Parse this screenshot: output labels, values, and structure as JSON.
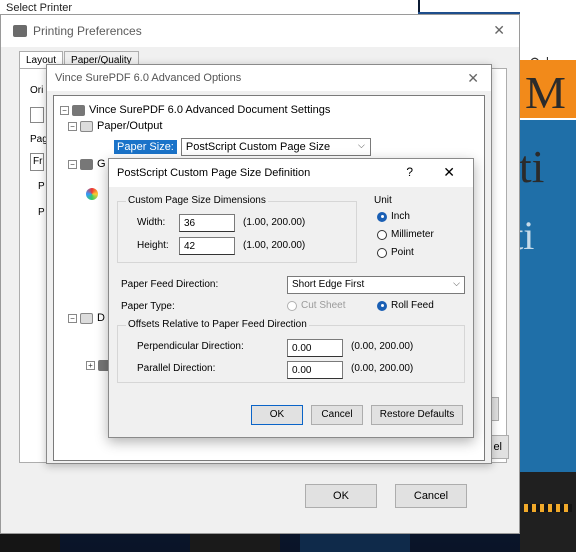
{
  "background": {
    "select_printer_title": "Select Printer",
    "slide_text": [
      "M",
      "eeti",
      "trati"
    ]
  },
  "printing_preferences": {
    "title": "Printing Preferences",
    "tabs": [
      "Layout",
      "Paper/Quality"
    ],
    "side_labels": [
      "Ori",
      "Pag",
      "Fr",
      "P",
      "P"
    ],
    "ok_label": "OK",
    "cancel_label": "Cancel",
    "el_label": "el"
  },
  "advanced_options": {
    "title": "Vince SurePDF 6.0 Advanced Options",
    "tree": {
      "root": "Vince SurePDF 6.0 Advanced Document Settings",
      "paper_output": "Paper/Output",
      "paper_size_label": "Paper Size:",
      "paper_size_value": "PostScript Custom Page Size",
      "g_label": "G",
      "d_label": "D"
    }
  },
  "custom_page_size": {
    "title": "PostScript Custom Page Size Definition",
    "help": "?",
    "close": "✕",
    "dimensions_group": "Custom Page Size Dimensions",
    "width_label": "Width:",
    "width_value": "36",
    "width_range": "(1.00, 200.00)",
    "height_label": "Height:",
    "height_value": "42",
    "height_range": "(1.00, 200.00)",
    "unit_group": "Unit",
    "unit_options": [
      "Inch",
      "Millimeter",
      "Point"
    ],
    "unit_selected": "Inch",
    "paper_feed_label": "Paper Feed Direction:",
    "paper_feed_value": "Short Edge First",
    "paper_type_label": "Paper Type:",
    "paper_type_options": [
      "Cut Sheet",
      "Roll Feed"
    ],
    "paper_type_selected": "Roll Feed",
    "offsets_group": "Offsets Relative to Paper Feed Direction",
    "perp_label": "Perpendicular Direction:",
    "perp_value": "0.00",
    "perp_range": "(0.00, 200.00)",
    "parallel_label": "Parallel Direction:",
    "parallel_value": "0.00",
    "parallel_range": "(0.00, 200.00)",
    "ok_label": "OK",
    "cancel_label": "Cancel",
    "restore_label": "Restore Defaults"
  },
  "colors": {
    "accent": "#1a5fb4",
    "selection": "#1a73c9",
    "slide_orange": "#f28a1a",
    "slide_blue": "#1f6fa8"
  }
}
